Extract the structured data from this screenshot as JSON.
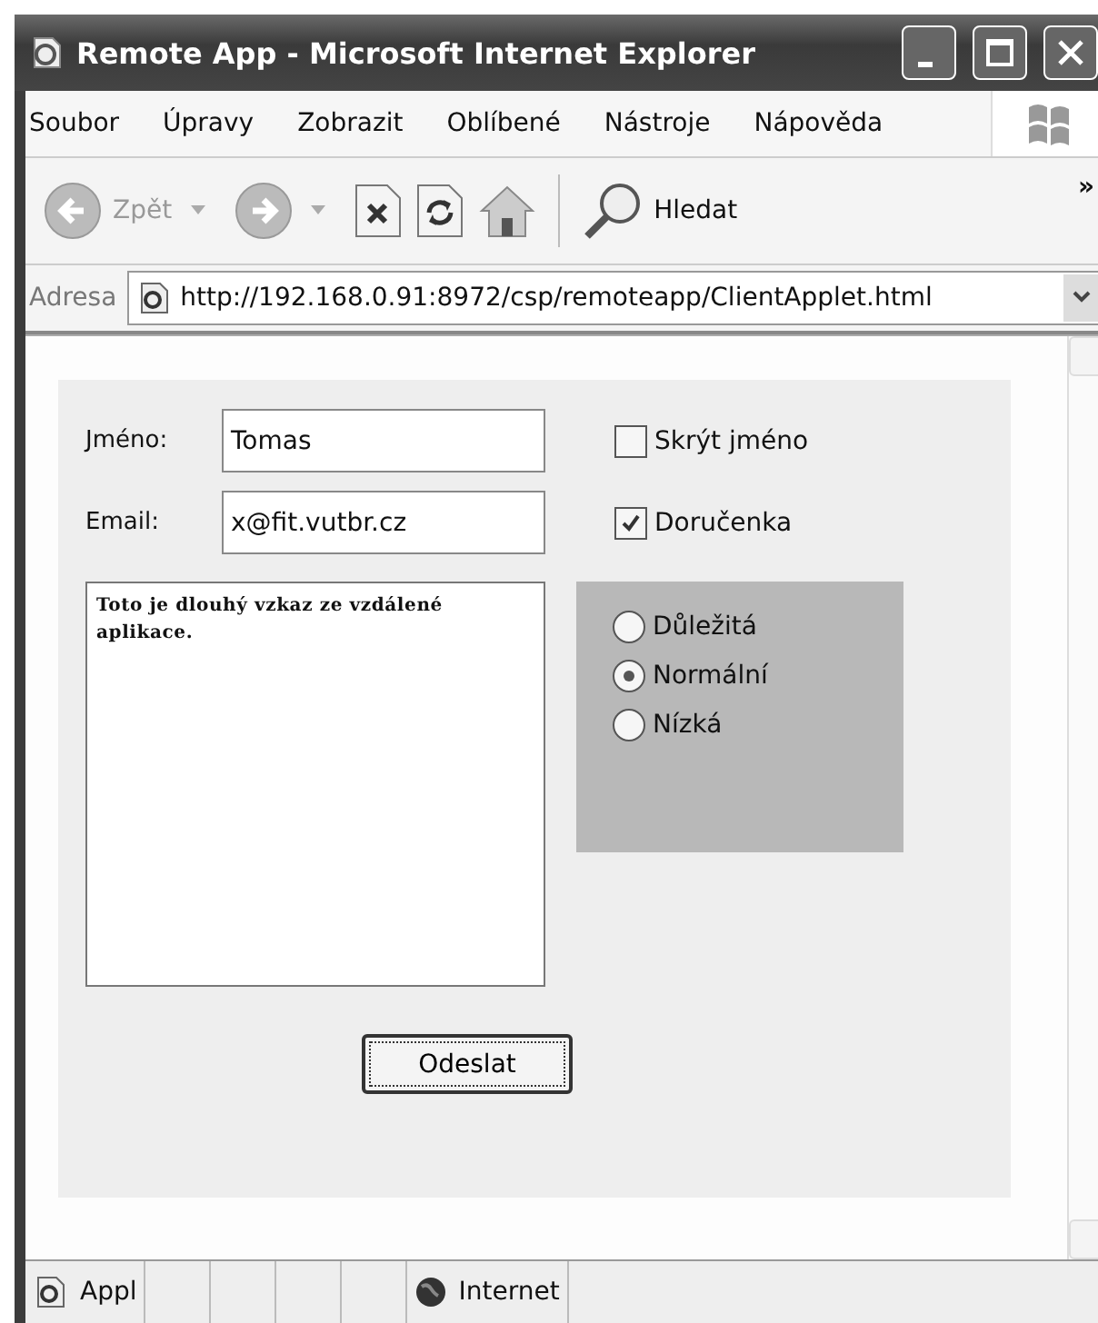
{
  "window": {
    "title": "Remote App - Microsoft Internet Explorer"
  },
  "menu": [
    "Soubor",
    "Úpravy",
    "Zobrazit",
    "Oblíbené",
    "Nástroje",
    "Nápověda"
  ],
  "toolbar": [
    {
      "kind": "back",
      "label": "Zpět"
    },
    {
      "kind": "forward"
    },
    {
      "kind": "stop"
    },
    {
      "kind": "refresh"
    },
    {
      "kind": "home"
    },
    {
      "kind": "search",
      "label": "Hledat"
    }
  ],
  "toolbar_overflow": "»",
  "address": {
    "label": "Adresa",
    "url": "http://192.168.0.91:8972/csp/remoteapp/ClientApplet.html"
  },
  "form": {
    "fields": [
      {
        "label": "Jméno:",
        "value": "Tomas"
      },
      {
        "label": "Email:",
        "value": "x@fit.vutbr.cz"
      }
    ],
    "checkboxes": [
      {
        "label": "Skrýt jméno",
        "checked": false
      },
      {
        "label": "Doručenka",
        "checked": true
      }
    ],
    "message": "Toto je dlouhý vzkaz ze vzdálené aplikace.",
    "priority": [
      {
        "label": "Důležitá",
        "selected": false
      },
      {
        "label": "Normální",
        "selected": true
      },
      {
        "label": "Nízká",
        "selected": false
      }
    ],
    "submit": "Odeslat"
  },
  "status_bar": {
    "text": "Appl",
    "zone": "Internet"
  }
}
